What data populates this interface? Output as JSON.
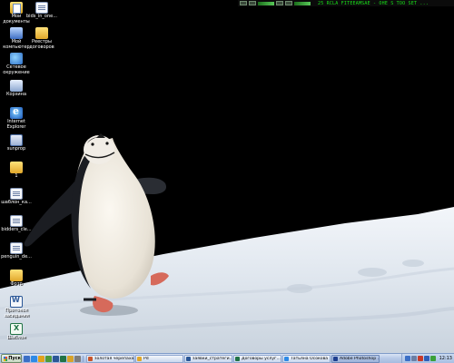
{
  "desktop": {
    "icons": [
      {
        "label": "Мои документы",
        "icon": "my-documents-icon",
        "style": "g-docs"
      },
      {
        "label": "Мой компьютер",
        "icon": "my-computer-icon",
        "style": "g-comp"
      },
      {
        "label": "Сетевое окружение",
        "icon": "network-icon",
        "style": "g-net"
      },
      {
        "label": "Корзина",
        "icon": "recycle-bin-icon",
        "style": "g-bin"
      },
      {
        "label": "Internet Explorer",
        "icon": "internet-explorer-icon",
        "style": "g-ie"
      },
      {
        "label": "sunprop",
        "icon": "application-icon",
        "style": "g-app"
      },
      {
        "label": "1",
        "icon": "folder-icon",
        "style": "g-folder"
      },
      {
        "label": "шаблон_ка...",
        "icon": "document-icon",
        "style": "g-file"
      },
      {
        "label": "bidders_cle...",
        "icon": "document-icon",
        "style": "g-file"
      },
      {
        "label": "penguin_de...",
        "icon": "document-icon",
        "style": "g-file"
      },
      {
        "label": "Фото",
        "icon": "folder-icon",
        "style": "g-folder"
      },
      {
        "label": "Протокол заседания",
        "icon": "word-document-icon",
        "style": "g-word"
      },
      {
        "label": "Шаблон",
        "icon": "excel-document-icon",
        "style": "g-excel"
      },
      {
        "label": "bids_in_one...",
        "icon": "document-icon",
        "style": "g-file"
      },
      {
        "label": "Реестры договоров",
        "icon": "folder-icon",
        "style": "g-folder"
      }
    ]
  },
  "top_widgets": {
    "status_text": "25 RCLA FITEEAMSAE - ОНЕ S TOO SET ..."
  },
  "taskbar": {
    "start_label": "Пуск",
    "quick_launch": [
      {
        "icon": "show-desktop-icon",
        "color": "#3b6fc6"
      },
      {
        "icon": "internet-explorer-icon",
        "color": "#2e8ae6"
      },
      {
        "icon": "outlook-icon",
        "color": "#e2a21c"
      },
      {
        "icon": "media-player-icon",
        "color": "#4f9a3a"
      },
      {
        "icon": "word-icon",
        "color": "#2b5797"
      },
      {
        "icon": "excel-icon",
        "color": "#217346"
      },
      {
        "icon": "explorer-icon",
        "color": "#d8a32a"
      },
      {
        "icon": "calculator-icon",
        "color": "#7d7d7d"
      }
    ],
    "buttons": [
      {
        "label": "золотая черепаха...",
        "icon": "browser-window-icon",
        "color": "#c8552c",
        "active": false
      },
      {
        "label": "Pd",
        "icon": "folder-window-icon",
        "color": "#e0a72a",
        "active": false
      },
      {
        "label": "заявки_стратеги...",
        "icon": "word-window-icon",
        "color": "#2b5797",
        "active": false
      },
      {
        "label": "Договоры услуг...",
        "icon": "excel-window-icon",
        "color": "#217346",
        "active": false
      },
      {
        "label": "Татьяна Осокова",
        "icon": "chat-window-icon",
        "color": "#2e8ae6",
        "active": false
      },
      {
        "label": "Adobe Photoshop ...",
        "icon": "photoshop-window-icon",
        "color": "#1f3f8f",
        "active": true
      }
    ],
    "tray_icons": [
      {
        "icon": "network-tray-icon",
        "color": "#3b6fc6"
      },
      {
        "icon": "volume-tray-icon",
        "color": "#6b7fa5"
      },
      {
        "icon": "antivirus-tray-icon",
        "color": "#c83a2a"
      },
      {
        "icon": "language-tray-icon",
        "color": "#2e5fb8"
      },
      {
        "icon": "messenger-tray-icon",
        "color": "#3aa03a"
      }
    ],
    "clock": "12:13"
  }
}
